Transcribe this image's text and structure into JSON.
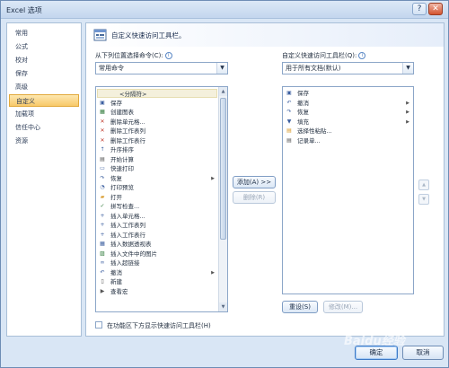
{
  "window": {
    "title": "Excel 选项",
    "help_glyph": "?",
    "close_glyph": "✕"
  },
  "sidebar": {
    "items": [
      {
        "label": "常用",
        "active": false
      },
      {
        "label": "公式",
        "active": false
      },
      {
        "label": "校对",
        "active": false
      },
      {
        "label": "保存",
        "active": false
      },
      {
        "label": "高级",
        "active": false
      },
      {
        "label": "自定义",
        "active": true
      },
      {
        "label": "加载项",
        "active": false
      },
      {
        "label": "信任中心",
        "active": false
      },
      {
        "label": "资源",
        "active": false
      }
    ]
  },
  "banner": {
    "title": "自定义快速访问工具栏。",
    "icon": "customize-toolbar-icon"
  },
  "left": {
    "label": "从下列位置选择命令(C):",
    "combo_value": "常用命令",
    "list": [
      {
        "text": "<分隔符>",
        "icon": "",
        "submenu": false,
        "separator": true
      },
      {
        "text": "保存",
        "icon": "save-icon",
        "submenu": false
      },
      {
        "text": "创建图表",
        "icon": "chart-icon",
        "submenu": false
      },
      {
        "text": "删除单元格...",
        "icon": "delete-cells-icon",
        "submenu": false
      },
      {
        "text": "删除工作表列",
        "icon": "delete-column-icon",
        "submenu": false
      },
      {
        "text": "删除工作表行",
        "icon": "delete-row-icon",
        "submenu": false
      },
      {
        "text": "升序排序",
        "icon": "sort-ascending-icon",
        "submenu": false
      },
      {
        "text": "开始计算",
        "icon": "calculate-icon",
        "submenu": false
      },
      {
        "text": "快速打印",
        "icon": "quick-print-icon",
        "submenu": false
      },
      {
        "text": "恢复",
        "icon": "redo-icon",
        "submenu": true
      },
      {
        "text": "打印预览",
        "icon": "print-preview-icon",
        "submenu": false
      },
      {
        "text": "打开",
        "icon": "open-folder-icon",
        "submenu": false
      },
      {
        "text": "拼写检查...",
        "icon": "spell-check-icon",
        "submenu": false
      },
      {
        "text": "插入单元格...",
        "icon": "insert-cells-icon",
        "submenu": false
      },
      {
        "text": "插入工作表列",
        "icon": "insert-column-icon",
        "submenu": false
      },
      {
        "text": "插入工作表行",
        "icon": "insert-row-icon",
        "submenu": false
      },
      {
        "text": "插入数据透视表",
        "icon": "pivot-table-icon",
        "submenu": false
      },
      {
        "text": "插入文件中的图片",
        "icon": "picture-icon",
        "submenu": false
      },
      {
        "text": "插入超链接",
        "icon": "hyperlink-icon",
        "submenu": false
      },
      {
        "text": "撤消",
        "icon": "undo-icon",
        "submenu": true
      },
      {
        "text": "新建",
        "icon": "new-document-icon",
        "submenu": false
      },
      {
        "text": "查看宏",
        "icon": "macro-icon",
        "submenu": false
      }
    ]
  },
  "right": {
    "label": "自定义快速访问工具栏(Q):",
    "combo_value": "用于所有文档(默认)",
    "list": [
      {
        "text": "保存",
        "icon": "save-icon",
        "submenu": false
      },
      {
        "text": "撤消",
        "icon": "undo-icon",
        "submenu": true
      },
      {
        "text": "恢复",
        "icon": "redo-icon",
        "submenu": true
      },
      {
        "text": "填充",
        "icon": "fill-icon",
        "submenu": true
      },
      {
        "text": "选择性粘贴...",
        "icon": "paste-special-icon",
        "submenu": false
      },
      {
        "text": "记录单...",
        "icon": "form-icon",
        "submenu": false
      }
    ]
  },
  "buttons": {
    "add": "添加(A) >>",
    "remove": "删除(R)",
    "reset": "重设(S)",
    "modify": "修改(M)...",
    "ok": "确定",
    "cancel": "取消"
  },
  "checkbox": {
    "label": "在功能区下方显示快速访问工具栏(H)",
    "checked": false
  },
  "watermark": "Baidu经验"
}
